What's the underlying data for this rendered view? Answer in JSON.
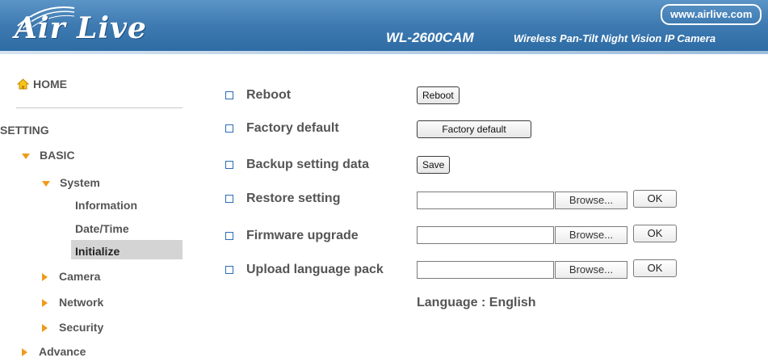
{
  "header": {
    "logo": "Air Live",
    "url": "www.airlive.com",
    "model": "WL-2600CAM",
    "description": "Wireless Pan-Tilt Night Vision IP Camera",
    "colors": {
      "header_blue": "#3f7bb2",
      "accent_orange": "#f09a1b",
      "bullet_blue": "#2b6cb8"
    }
  },
  "sidebar": {
    "home": {
      "icon": "home-icon",
      "label": "HOME"
    },
    "setting_label": "SETTING",
    "basic": {
      "label": "BASIC",
      "expanded": true
    },
    "system": {
      "label": "System",
      "expanded": true
    },
    "system_items": [
      {
        "label": "Information",
        "selected": false
      },
      {
        "label": "Date/Time",
        "selected": false
      },
      {
        "label": "Initialize",
        "selected": true
      }
    ],
    "basic_items": [
      {
        "label": "Camera"
      },
      {
        "label": "Network"
      },
      {
        "label": "Security"
      }
    ],
    "advance": {
      "label": "Advance"
    }
  },
  "main": {
    "rows": [
      {
        "label": "Reboot",
        "button": "Reboot"
      },
      {
        "label": "Factory default",
        "button": "Factory default"
      },
      {
        "label": "Backup setting data",
        "button": "Save"
      },
      {
        "label": "Restore setting",
        "browse": "Browse...",
        "ok": "OK",
        "value": ""
      },
      {
        "label": "Firmware upgrade",
        "browse": "Browse...",
        "ok": "OK",
        "value": ""
      },
      {
        "label": "Upload language pack",
        "browse": "Browse...",
        "ok": "OK",
        "value": ""
      }
    ],
    "language": "Language : English"
  }
}
